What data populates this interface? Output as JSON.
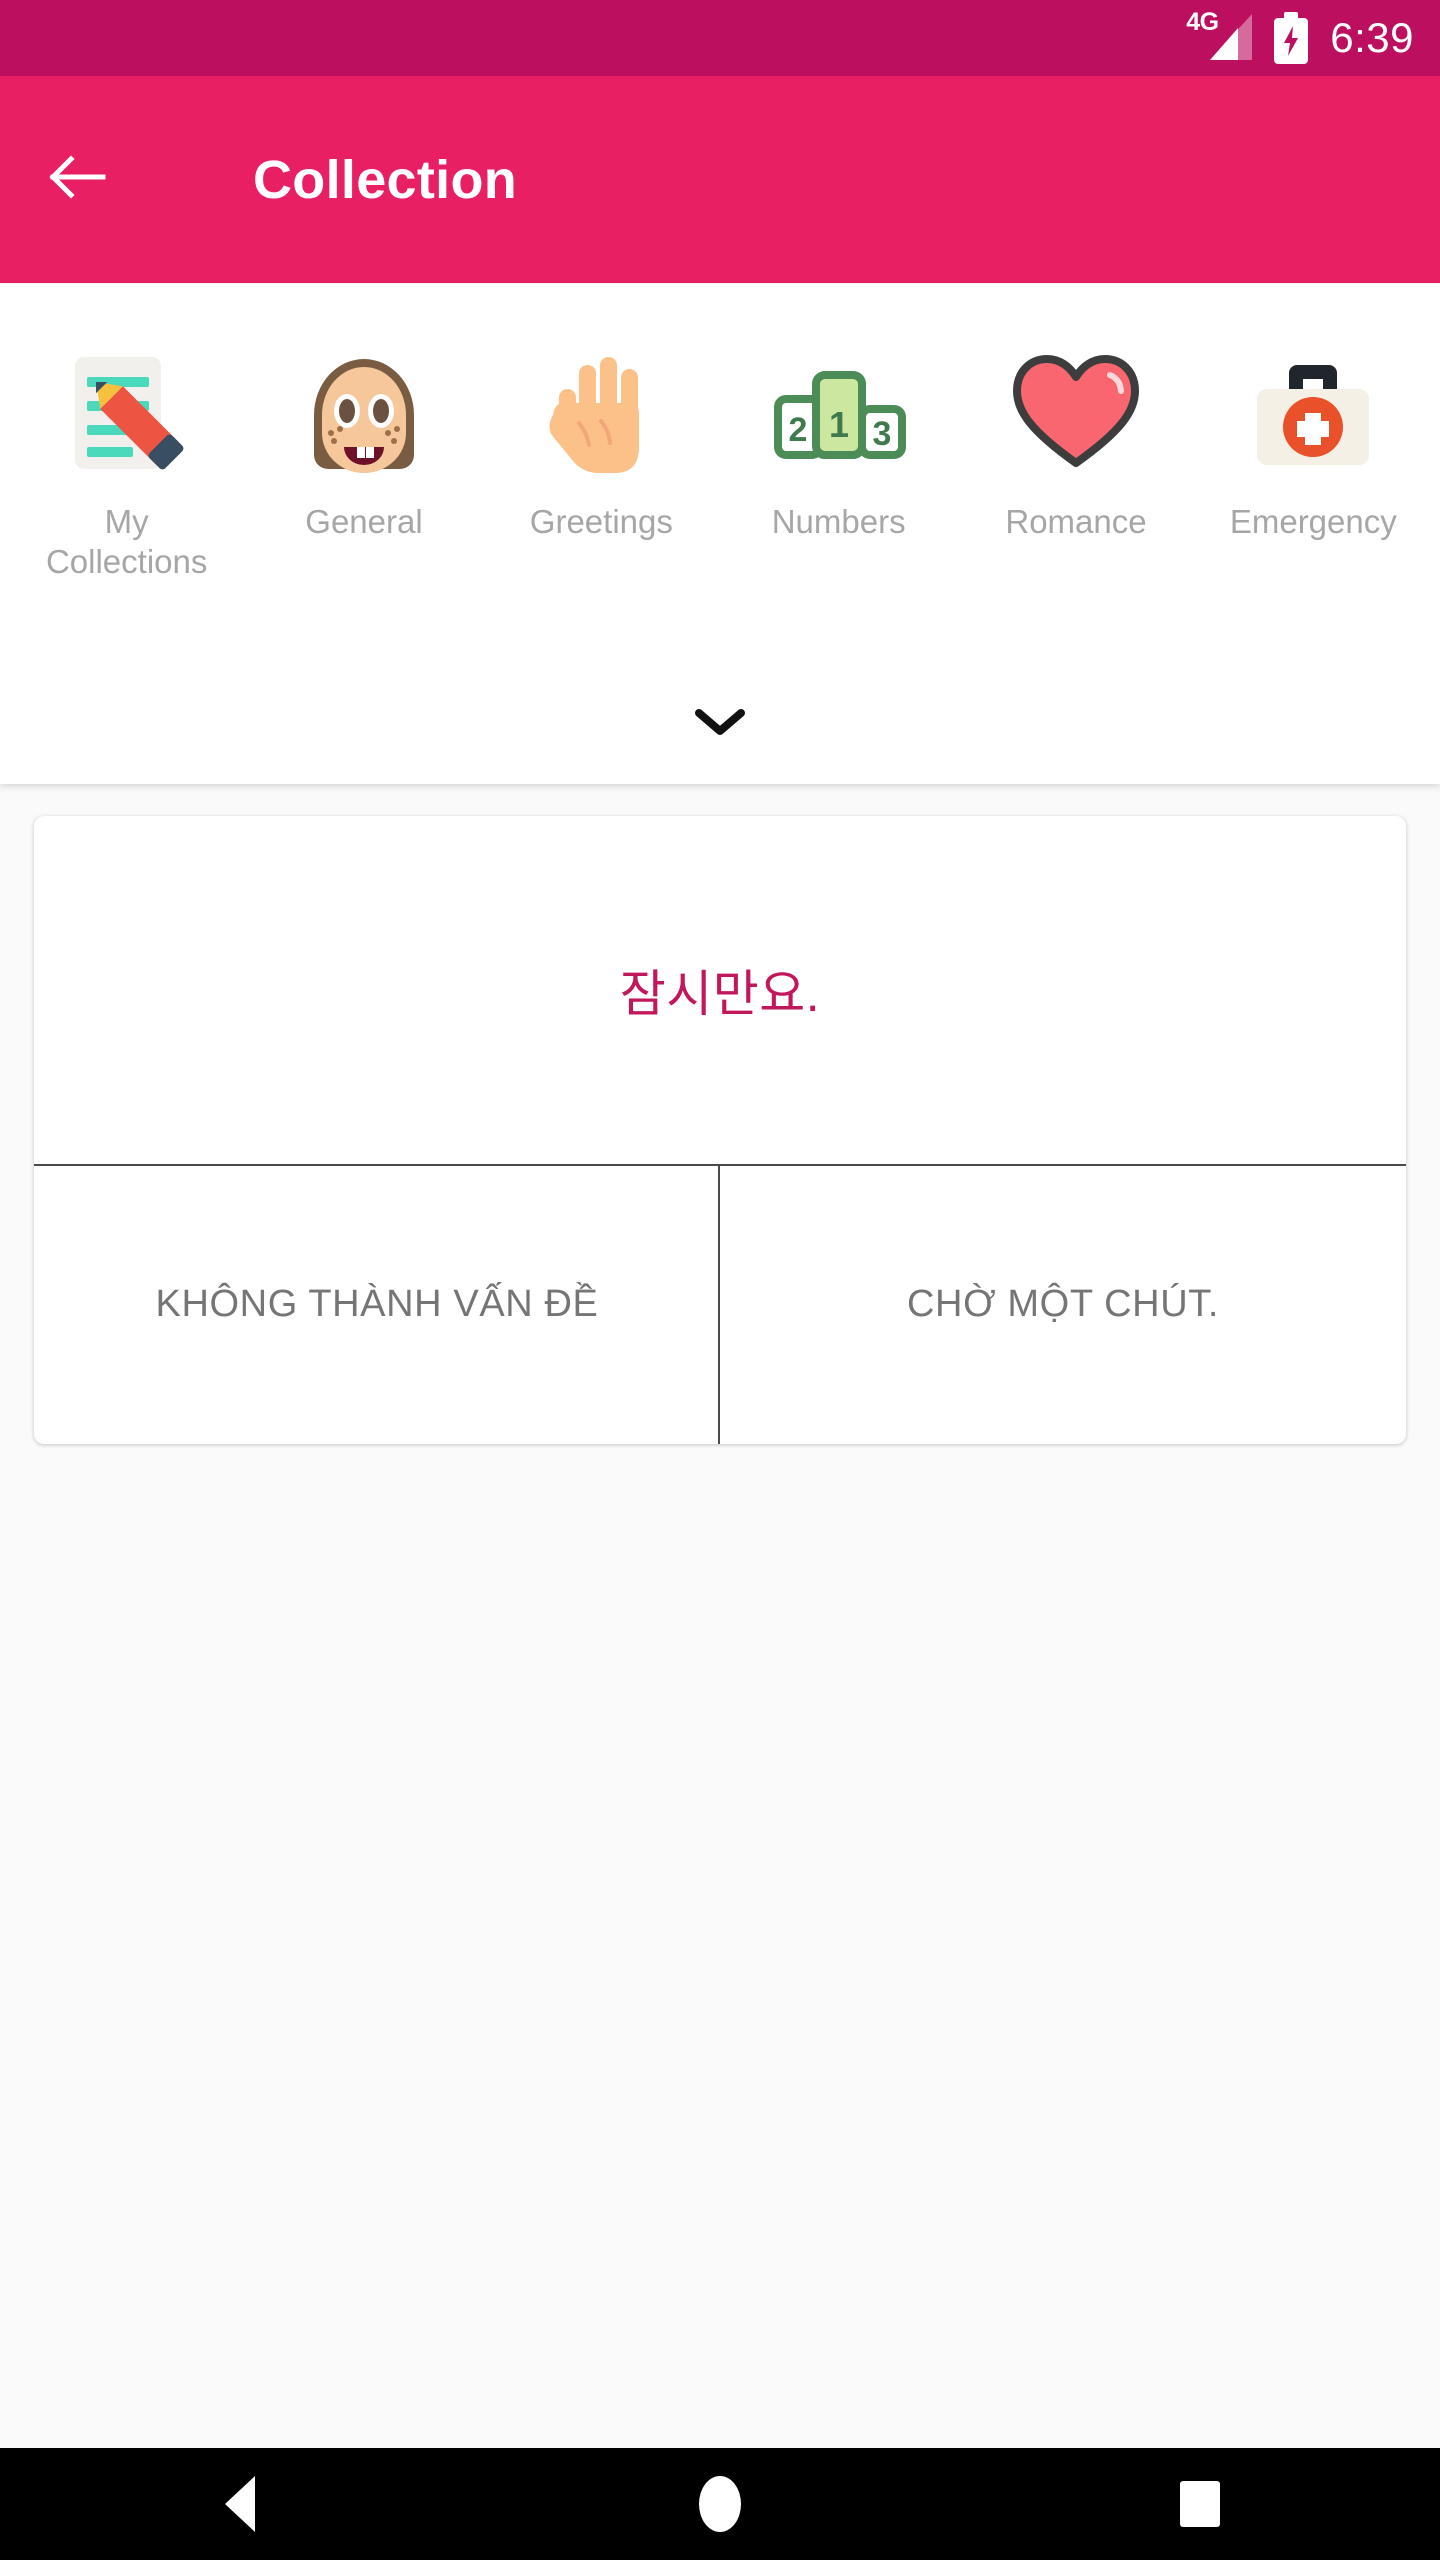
{
  "status_bar": {
    "network_label": "4G",
    "signal_icon": "signal-bars-icon",
    "battery_icon": "battery-charging-icon",
    "time": "6:39",
    "background_color": "#bd0f5f"
  },
  "app_bar": {
    "back_icon": "arrow-left-icon",
    "title": "Collection",
    "background_color": "#e81f62"
  },
  "categories": {
    "expand_icon": "chevron-down-icon",
    "items": [
      {
        "label": "My Collections",
        "icon": "memo-pencil-icon",
        "selected": false
      },
      {
        "label": "General",
        "icon": "girl-face-icon",
        "selected": false
      },
      {
        "label": "Greetings",
        "icon": "raised-hand-icon",
        "selected": false
      },
      {
        "label": "Numbers",
        "icon": "podium-123-icon",
        "selected": false
      },
      {
        "label": "Romance",
        "icon": "heart-icon",
        "selected": false
      },
      {
        "label": "Emergency",
        "icon": "first-aid-kit-icon",
        "selected": false
      }
    ]
  },
  "phrase_card": {
    "phrase": "잠시만요.",
    "phrase_color": "#c2185b",
    "actions": [
      {
        "label": "KHÔNG THÀNH VẤN ĐỀ"
      },
      {
        "label": "CHỜ MỘT CHÚT."
      }
    ]
  },
  "nav_bar": {
    "back_icon": "triangle-back-icon",
    "home_icon": "circle-home-icon",
    "recents_icon": "square-recents-icon"
  }
}
